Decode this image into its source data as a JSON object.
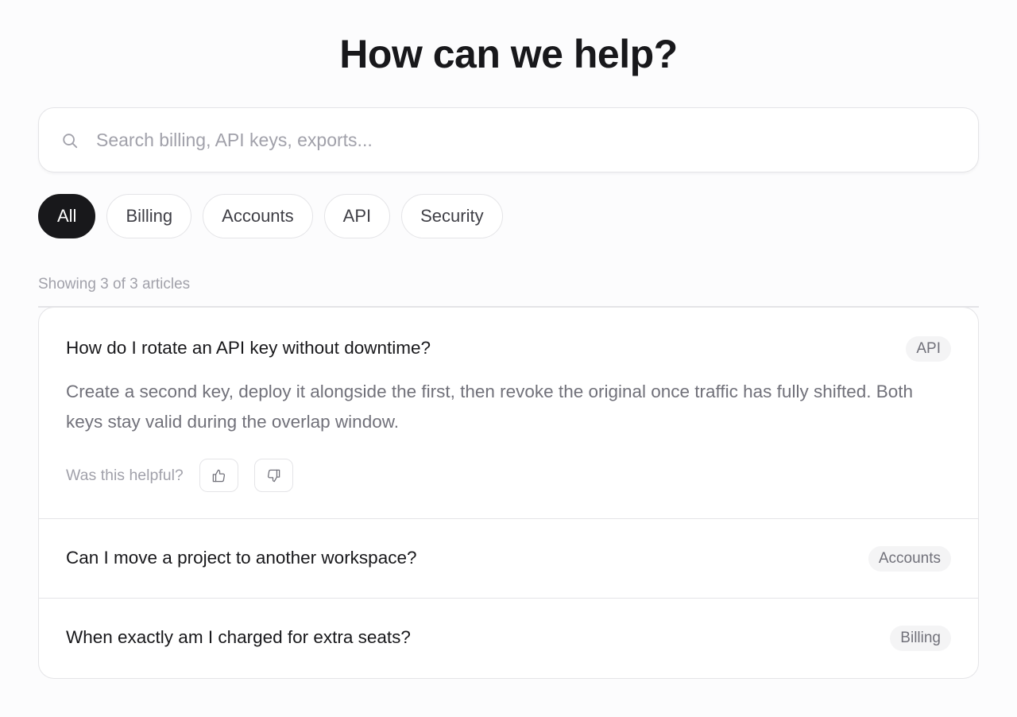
{
  "header": {
    "title": "How can we help?"
  },
  "search": {
    "placeholder": "Search billing, API keys, exports...",
    "value": "",
    "icon": "search-icon"
  },
  "filters": {
    "active": "All",
    "items": [
      {
        "label": "All",
        "active": true
      },
      {
        "label": "Billing",
        "active": false
      },
      {
        "label": "Accounts",
        "active": false
      },
      {
        "label": "API",
        "active": false
      },
      {
        "label": "Security",
        "active": false
      }
    ]
  },
  "results": {
    "count_text": "Showing 3 of 3 articles"
  },
  "articles": [
    {
      "title": "How do I rotate an API key without downtime?",
      "tag": "API",
      "expanded": true,
      "body": "Create a second key, deploy it alongside the first, then revoke the original once traffic has fully shifted. Both keys stay valid during the overlap window.",
      "feedback": {
        "label": "Was this helpful?",
        "up_icon": "thumbs-up-icon",
        "down_icon": "thumbs-down-icon"
      }
    },
    {
      "title": "Can I move a project to another workspace?",
      "tag": "Accounts",
      "expanded": false
    },
    {
      "title": "When exactly am I charged for extra seats?",
      "tag": "Billing",
      "expanded": false
    }
  ],
  "colors": {
    "background": "#fcfcfd",
    "text_primary": "#18181b",
    "text_muted": "#71717a",
    "text_faint": "#a1a1aa",
    "border": "#e4e4e7",
    "chip_active_bg": "#18181b",
    "tag_bg": "#f4f4f5"
  }
}
